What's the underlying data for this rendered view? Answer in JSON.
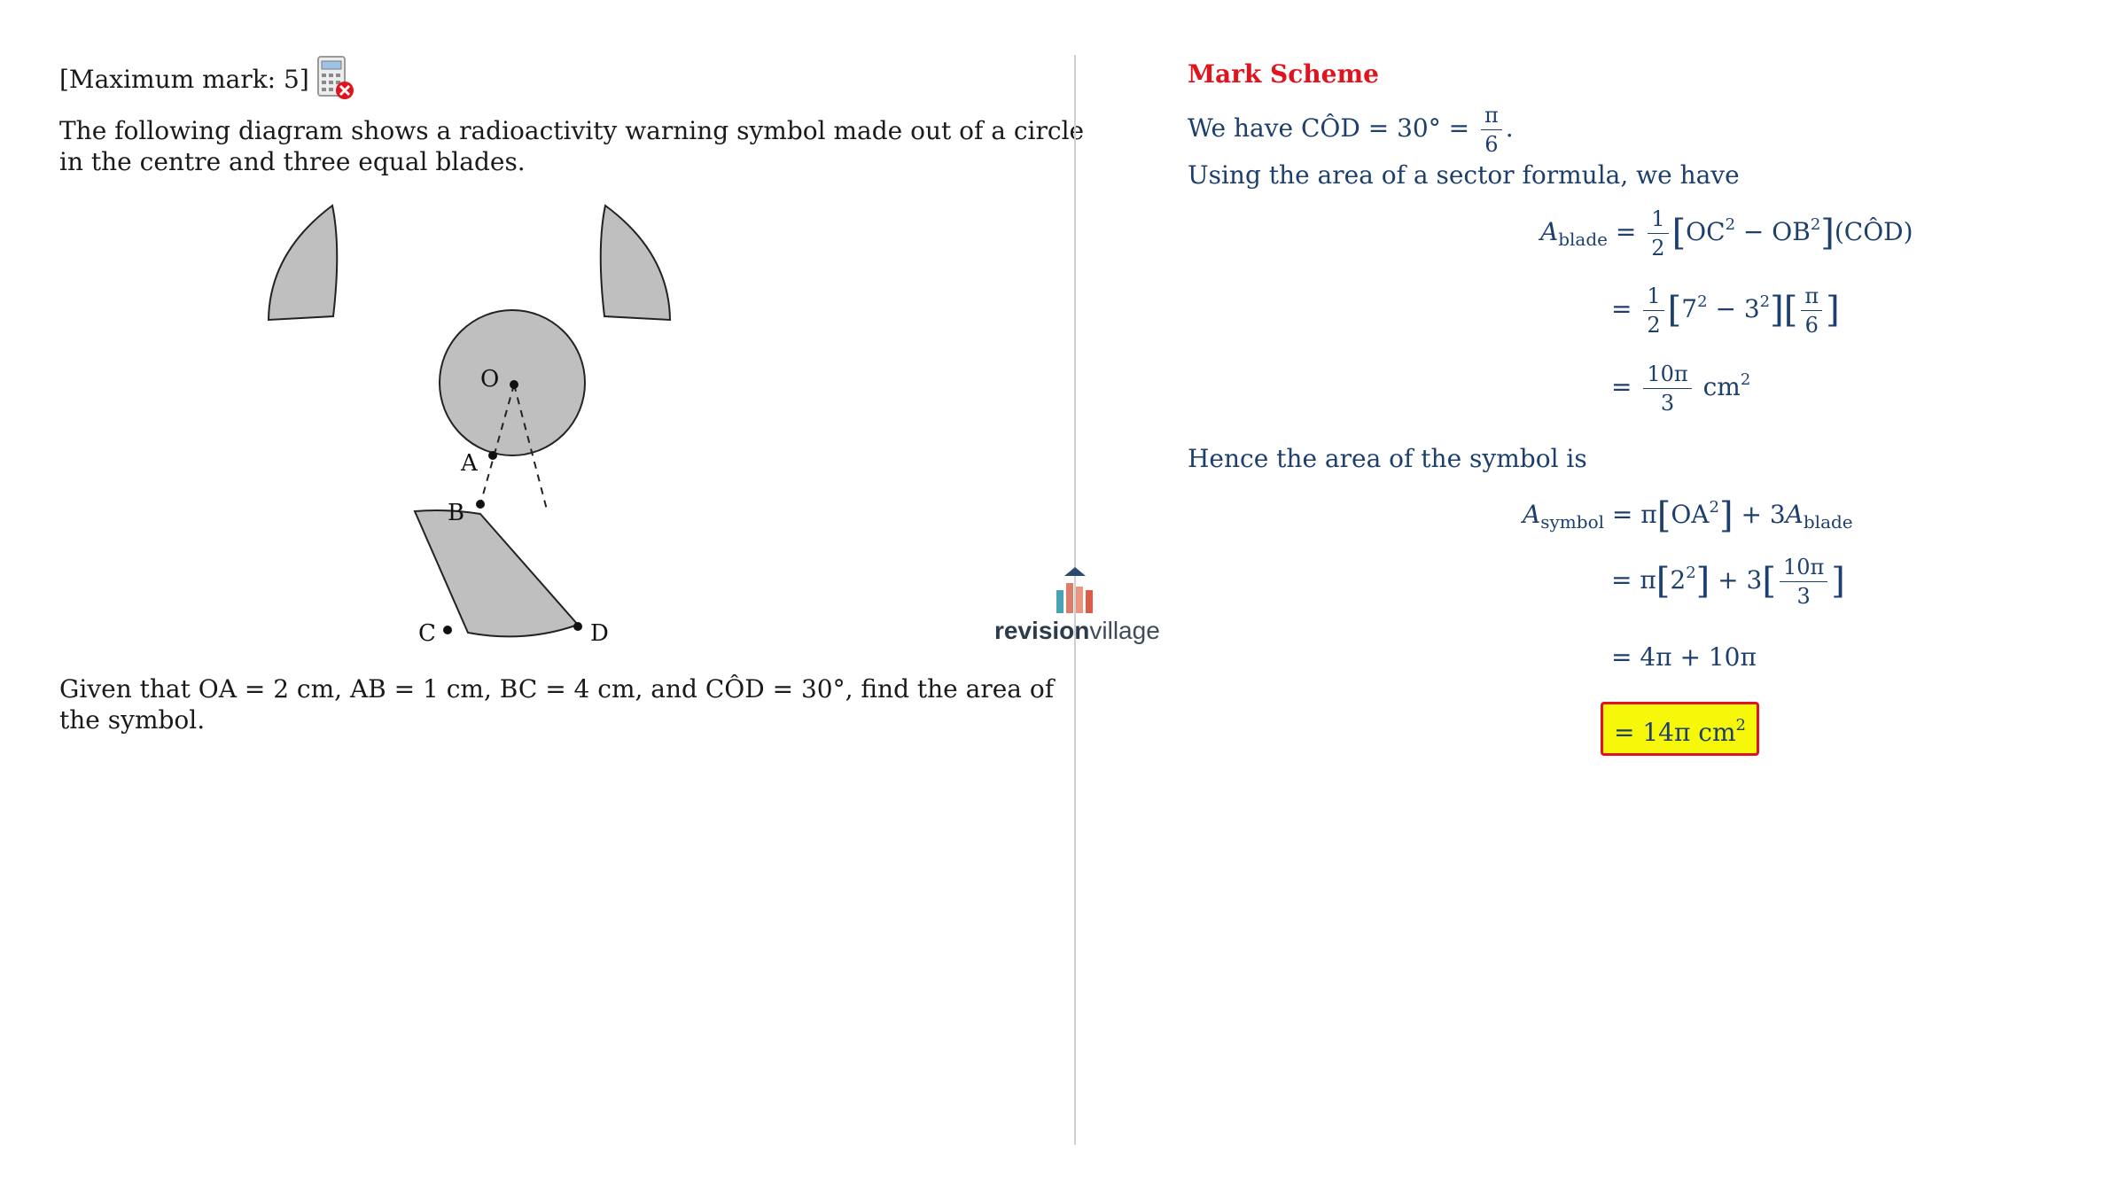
{
  "question": {
    "max_mark": "[Maximum mark: 5]",
    "calculator_icon": "calculator-not-allowed-icon",
    "intro_line1": "The following diagram shows a radioactivity warning symbol made out of a circle",
    "intro_line2": "in the centre and three equal blades.",
    "given_line1": "Given that OA = 2 cm, AB = 1 cm, BC = 4 cm, and CÔD = 30°, find the area of",
    "given_line2": "the symbol.",
    "diagram_labels": {
      "O": "O",
      "A": "A",
      "B": "B",
      "C": "C",
      "D": "D"
    }
  },
  "logo": {
    "bold": "revision",
    "light": "village"
  },
  "markscheme": {
    "title": "Mark Scheme",
    "line1_prefix": "We have CÔD = 30° = ",
    "pi": "π",
    "six": "6",
    "period": ".",
    "line2": "Using the area of a sector formula, we have",
    "A": "A",
    "blade": "blade",
    "symbol": "symbol",
    "eq": "=",
    "one": "1",
    "two": "2",
    "three": "3",
    "ten_pi": "10π",
    "cm": "cm",
    "oc": "OC",
    "ob": "OB",
    "minus": " − ",
    "cod": "(CÔD)",
    "seven": "7",
    "hence": "Hence the area of the symbol is",
    "oa": "OA",
    "plus3A": " + 3",
    "plus3": " + 3",
    "result1": "= 4π + 10π",
    "answer": "= 14π cm",
    "sq": "2"
  },
  "colors": {
    "accent": "#e0141e",
    "math": "#1d3f6e",
    "highlight": "#f7f70a",
    "blade_fill": "#bfbfbf"
  }
}
